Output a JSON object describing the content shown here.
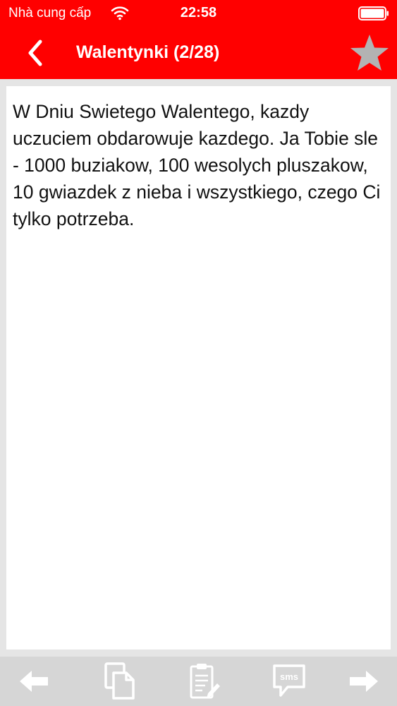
{
  "status_bar": {
    "carrier": "Nhà cung cấp",
    "time": "22:58",
    "icons": [
      "wifi-icon",
      "battery-icon"
    ]
  },
  "nav": {
    "title": "Walentynki (2/28)",
    "back_icon": "chevron-left-icon",
    "favorite_icon": "star-icon"
  },
  "message": {
    "text": "W Dniu Swietego Walentego, kazdy uczuciem obdarowuje kazdego. Ja Tobie sle - 1000 buziakow, 100 wesolych pluszakow, 10 gwiazdek z nieba i wszystkiego, czego Ci tylko potrzeba."
  },
  "toolbar": {
    "items": [
      {
        "icon": "arrow-left-icon"
      },
      {
        "icon": "copy-icon"
      },
      {
        "icon": "clipboard-edit-icon"
      },
      {
        "icon": "sms-icon",
        "label": "sms"
      },
      {
        "icon": "arrow-right-icon"
      }
    ]
  },
  "colors": {
    "header_bg": "#ff0000",
    "header_text": "#ffffff",
    "page_bg": "#e5e5e5",
    "card_bg": "#ffffff",
    "toolbar_bg": "#d6d6d6",
    "toolbar_icon": "#ffffff",
    "star_fill": "#b3b3b3"
  }
}
